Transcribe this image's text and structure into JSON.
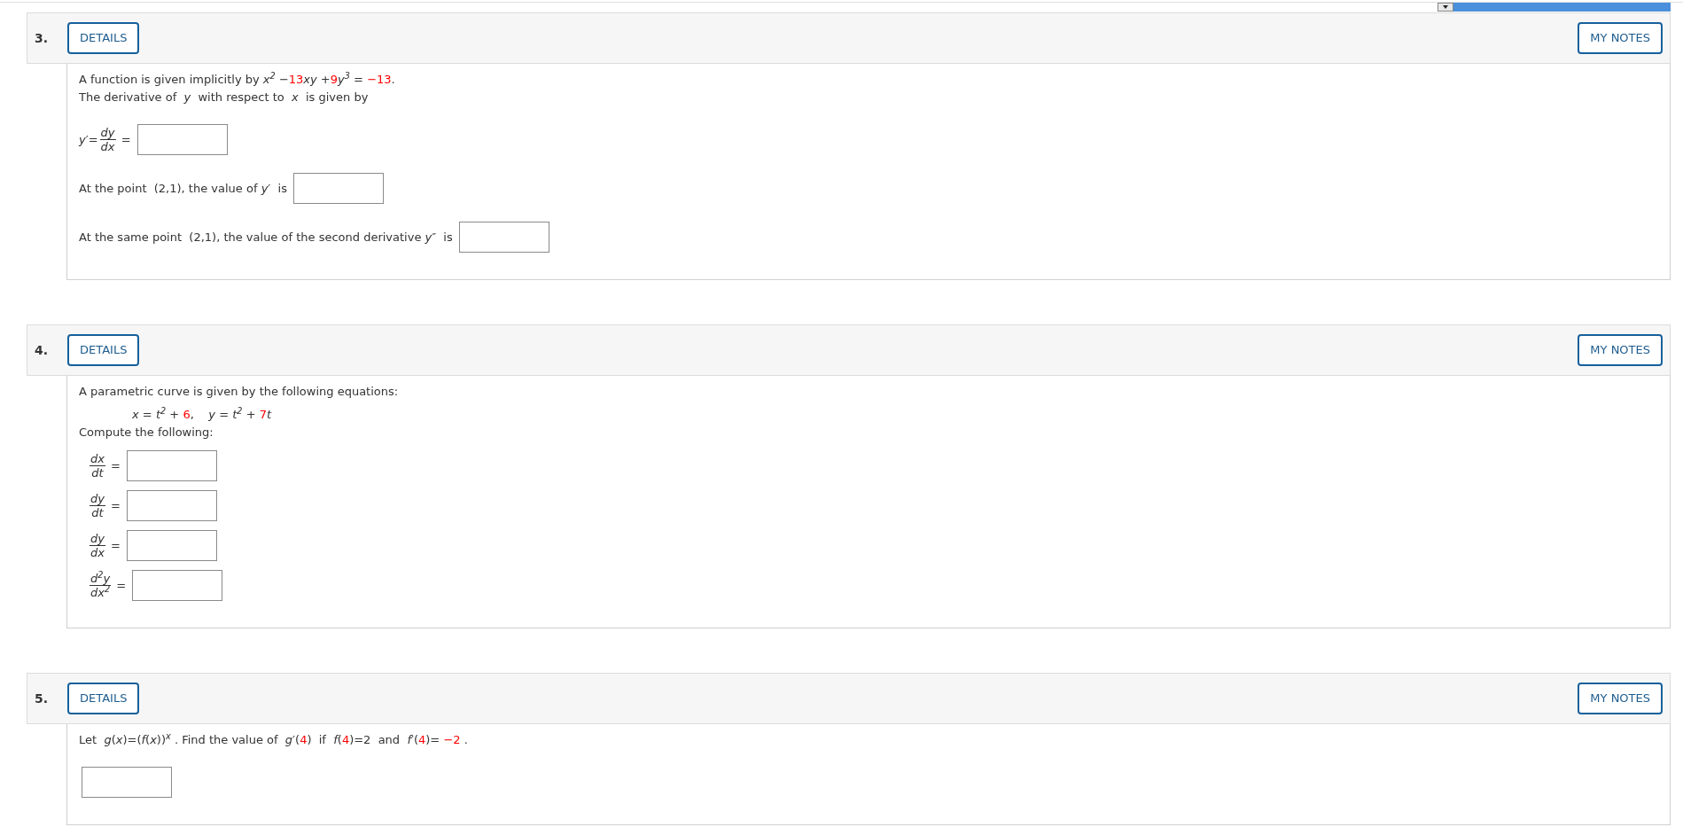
{
  "problems": [
    {
      "number": "3.",
      "details_button": "DETAILS",
      "notes_button": "MY NOTES",
      "body": [
        {
          "kind": "text_line",
          "segments": [
            {
              "kind": "text",
              "text": "A function is given implicitly by "
            },
            {
              "kind": "math",
              "text": "x$^{2}$"
            },
            {
              "kind": "text",
              "text": " −"
            },
            {
              "kind": "param",
              "text": "13"
            },
            {
              "kind": "math",
              "text": "xy"
            },
            {
              "kind": "text",
              "text": " +"
            },
            {
              "kind": "param",
              "text": "9"
            },
            {
              "kind": "math",
              "text": "y$^{3}$"
            },
            {
              "kind": "text",
              "text": " = "
            },
            {
              "kind": "param",
              "text": "−13"
            },
            {
              "kind": "text",
              "text": "."
            }
          ]
        },
        {
          "kind": "text_line",
          "segments": [
            {
              "kind": "text",
              "text": "The derivative of  "
            },
            {
              "kind": "math",
              "text": "y"
            },
            {
              "kind": "text",
              "text": "  with respect to  "
            },
            {
              "kind": "math",
              "text": "x"
            },
            {
              "kind": "text",
              "text": "  is given by"
            }
          ]
        },
        {
          "kind": "answer_line",
          "segments": [
            {
              "kind": "math",
              "text": "y′="
            },
            {
              "kind": "fraction",
              "numerator": "dy",
              "denominator": "dx"
            },
            {
              "kind": "text",
              "text": " = "
            },
            {
              "kind": "answer"
            }
          ]
        },
        {
          "kind": "answer_line",
          "segments": [
            {
              "kind": "text",
              "text": "At the point  (2,1), the value of "
            },
            {
              "kind": "math",
              "text": "y′"
            },
            {
              "kind": "text",
              "text": "  is "
            },
            {
              "kind": "answer"
            }
          ]
        },
        {
          "kind": "answer_line",
          "segments": [
            {
              "kind": "text",
              "text": "At the same point  (2,1), the value of the second derivative "
            },
            {
              "kind": "math",
              "text": "y″"
            },
            {
              "kind": "text",
              "text": "  is "
            },
            {
              "kind": "answer"
            }
          ]
        }
      ]
    },
    {
      "number": "4.",
      "details_button": "DETAILS",
      "notes_button": "MY NOTES",
      "body": [
        {
          "kind": "text_line",
          "segments": [
            {
              "kind": "text",
              "text": "A parametric curve is given by the following equations:"
            }
          ]
        },
        {
          "kind": "equation_line",
          "segments": [
            {
              "kind": "math",
              "text": "x"
            },
            {
              "kind": "text",
              "text": " = "
            },
            {
              "kind": "math",
              "text": "t$^{2}$"
            },
            {
              "kind": "text",
              "text": " + "
            },
            {
              "kind": "param",
              "text": "6"
            },
            {
              "kind": "text",
              "text": ",    "
            },
            {
              "kind": "math",
              "text": "y"
            },
            {
              "kind": "text",
              "text": " = "
            },
            {
              "kind": "math",
              "text": "t$^{2}$"
            },
            {
              "kind": "text",
              "text": " + "
            },
            {
              "kind": "param",
              "text": "7"
            },
            {
              "kind": "math",
              "text": "t"
            }
          ]
        },
        {
          "kind": "text_line",
          "segments": [
            {
              "kind": "text",
              "text": "Compute the following:"
            }
          ]
        },
        {
          "kind": "fraction_line",
          "segments": [
            {
              "kind": "fraction",
              "numerator": "dx",
              "denominator": "dt"
            },
            {
              "kind": "text",
              "text": " = "
            },
            {
              "kind": "answer"
            }
          ]
        },
        {
          "kind": "fraction_line",
          "segments": [
            {
              "kind": "fraction",
              "numerator": "dy",
              "denominator": "dt"
            },
            {
              "kind": "text",
              "text": " = "
            },
            {
              "kind": "answer"
            }
          ]
        },
        {
          "kind": "fraction_line",
          "segments": [
            {
              "kind": "fraction",
              "numerator": "dy",
              "denominator": "dx"
            },
            {
              "kind": "text",
              "text": " = "
            },
            {
              "kind": "answer"
            }
          ]
        },
        {
          "kind": "fraction_line",
          "segments": [
            {
              "kind": "fraction",
              "numerator": "d$^{2}$y",
              "denominator": "dx$^{2}$"
            },
            {
              "kind": "text",
              "text": " = "
            },
            {
              "kind": "answer"
            }
          ]
        }
      ]
    },
    {
      "number": "5.",
      "details_button": "DETAILS",
      "notes_button": "MY NOTES",
      "body": [
        {
          "kind": "text_line",
          "segments": [
            {
              "kind": "text",
              "text": "Let  "
            },
            {
              "kind": "math",
              "text": "g"
            },
            {
              "kind": "text",
              "text": "("
            },
            {
              "kind": "math",
              "text": "x"
            },
            {
              "kind": "text",
              "text": ")=("
            },
            {
              "kind": "math",
              "text": "f"
            },
            {
              "kind": "text",
              "text": "("
            },
            {
              "kind": "math",
              "text": "x"
            },
            {
              "kind": "text",
              "text": "))"
            },
            {
              "kind": "math",
              "text": "$^{x}$"
            },
            {
              "kind": "text",
              "text": " . Find the value of  "
            },
            {
              "kind": "math",
              "text": "g"
            },
            {
              "kind": "text",
              "text": "′("
            },
            {
              "kind": "param",
              "text": "4"
            },
            {
              "kind": "text",
              "text": ")  if  "
            },
            {
              "kind": "math",
              "text": "f"
            },
            {
              "kind": "text",
              "text": "("
            },
            {
              "kind": "param",
              "text": "4"
            },
            {
              "kind": "text",
              "text": ")=2  and  "
            },
            {
              "kind": "math",
              "text": "f"
            },
            {
              "kind": "text",
              "text": "′("
            },
            {
              "kind": "param",
              "text": "4"
            },
            {
              "kind": "text",
              "text": ")= "
            },
            {
              "kind": "param",
              "text": "−2"
            },
            {
              "kind": "text",
              "text": " ."
            }
          ]
        },
        {
          "kind": "answer_line",
          "segments": [
            {
              "kind": "answer"
            }
          ]
        }
      ]
    }
  ]
}
